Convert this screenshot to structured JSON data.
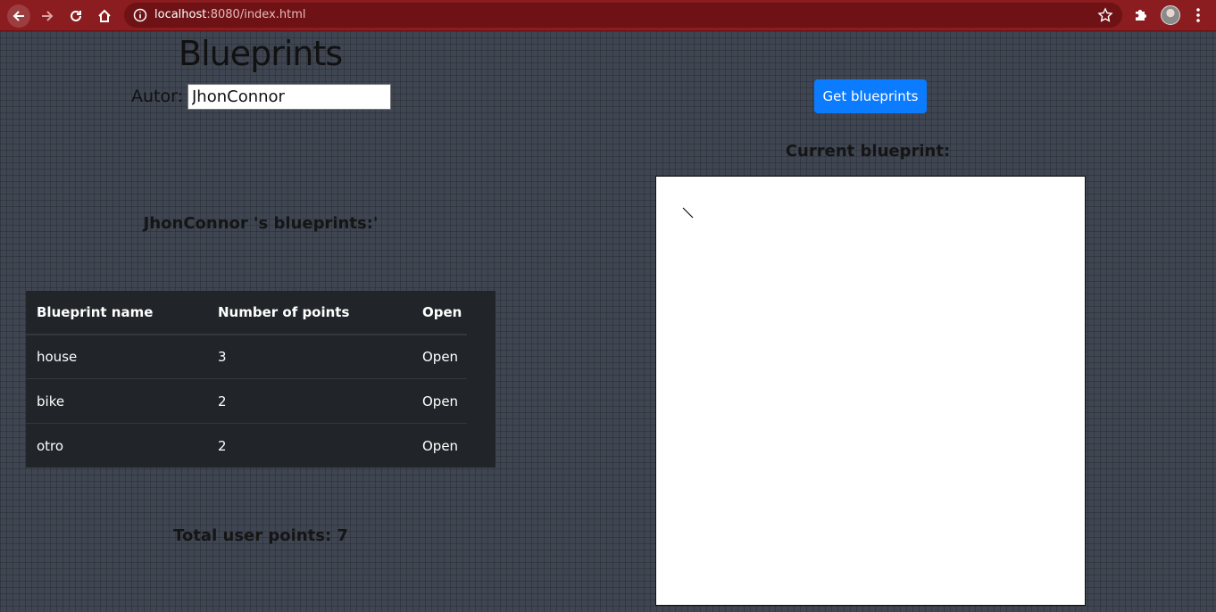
{
  "browser": {
    "url_host": "localhost",
    "url_rest": ":8080/index.html"
  },
  "page": {
    "title": "Blueprints",
    "author_label": "Autor:",
    "author_value": "JhonConnor",
    "get_button": "Get blueprints",
    "current_label": "Current blueprint:",
    "user_blueprints_title": "JhonConnor 's blueprints:'",
    "total_points": "Total user points: 7"
  },
  "table": {
    "headers": [
      "Blueprint name",
      "Number of points",
      "Open"
    ],
    "rows": [
      {
        "name": "house",
        "points": "3",
        "open": "Open"
      },
      {
        "name": "bike",
        "points": "2",
        "open": "Open"
      },
      {
        "name": "otro",
        "points": "2",
        "open": "Open"
      }
    ]
  },
  "icons": {
    "back": "arrow-left-icon",
    "forward": "arrow-right-icon",
    "reload": "reload-icon",
    "home": "home-icon",
    "info": "info-icon",
    "star": "star-icon",
    "extensions": "puzzle-icon",
    "menu": "kebab-menu-icon"
  },
  "colors": {
    "browser_bar": "#8b1c1f",
    "button": "#0b7bff",
    "table_bg": "#212529"
  }
}
